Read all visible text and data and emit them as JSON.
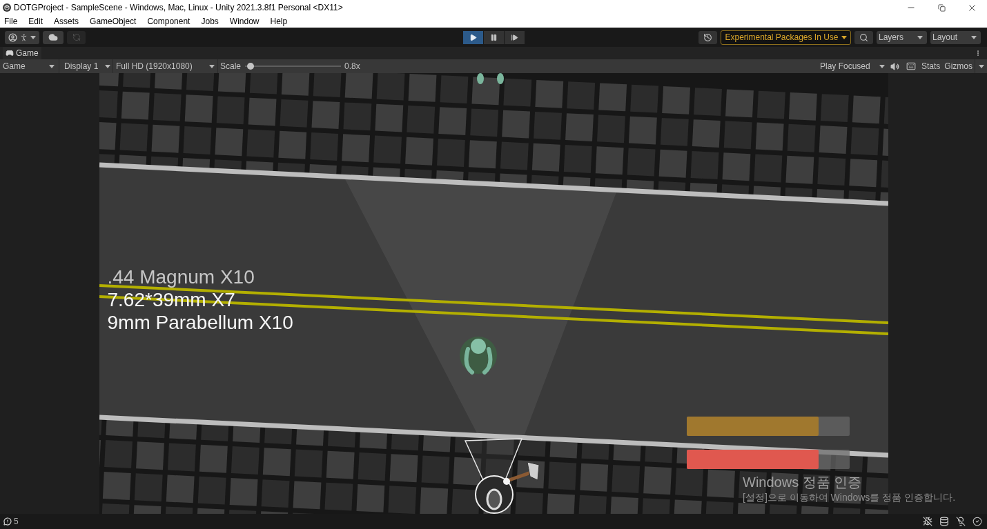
{
  "window": {
    "title": "DOTGProject - SampleScene - Windows, Mac, Linux - Unity 2021.3.8f1 Personal <DX11>"
  },
  "menu_bar": [
    "File",
    "Edit",
    "Assets",
    "GameObject",
    "Component",
    "Jobs",
    "Window",
    "Help"
  ],
  "toolbar": {
    "collab": {
      "disabled": true
    },
    "play_controls": [
      {
        "kind": "play",
        "on": true
      },
      {
        "kind": "pause",
        "on": false
      },
      {
        "kind": "step",
        "on": false
      }
    ],
    "packages_notice": "Experimental Packages In Use",
    "layers": "Layers",
    "layout": "Layout"
  },
  "tabs": [
    {
      "label": "Game",
      "selected": true
    }
  ],
  "game_toolbar": {
    "view": "Game",
    "display": "Display 1",
    "resolution": "Full HD (1920x1080)",
    "scale_label": "Scale",
    "scale": {
      "level": 0.02
    },
    "scale_reading": "0.8x",
    "play_mode": "Play Focused",
    "mute_audio": {
      "on": false
    },
    "stats": {
      "label": "Stats",
      "on": false
    },
    "gizmos": {
      "label": "Gizmos",
      "on": false
    }
  },
  "game_view": {
    "ammo": [
      {
        "text": ".44 Magnum X10",
        "dimmed": true
      },
      {
        "text": "7.62*39mm X7",
        "dimmed": false
      },
      {
        "text": "9mm Parabellum X10",
        "dimmed": false
      }
    ],
    "meters": [
      {
        "color": "#a0782e",
        "level": 0.81
      },
      {
        "color": "#e0584f",
        "level": 0.81
      }
    ]
  },
  "os_notice": {
    "title": "Windows 정품 인증",
    "message": "[설정]으로 이동하여 Windows를 정품 인증합니다."
  },
  "status_bar": {
    "warning_count": "5"
  }
}
